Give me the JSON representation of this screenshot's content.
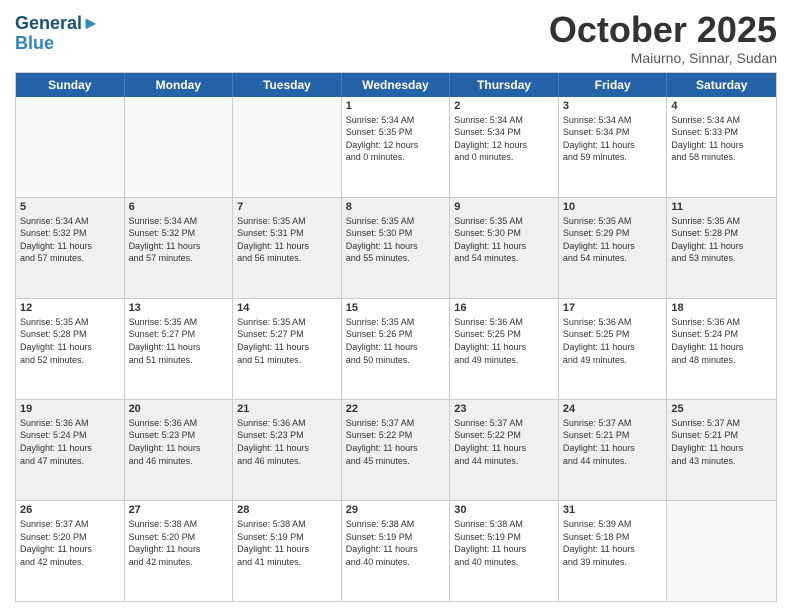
{
  "header": {
    "logo_line1": "General",
    "logo_line2": "Blue",
    "month": "October 2025",
    "location": "Maiurno, Sinnar, Sudan"
  },
  "day_names": [
    "Sunday",
    "Monday",
    "Tuesday",
    "Wednesday",
    "Thursday",
    "Friday",
    "Saturday"
  ],
  "weeks": [
    [
      {
        "day": "",
        "info": ""
      },
      {
        "day": "",
        "info": ""
      },
      {
        "day": "",
        "info": ""
      },
      {
        "day": "1",
        "info": "Sunrise: 5:34 AM\nSunset: 5:35 PM\nDaylight: 12 hours\nand 0 minutes."
      },
      {
        "day": "2",
        "info": "Sunrise: 5:34 AM\nSunset: 5:34 PM\nDaylight: 12 hours\nand 0 minutes."
      },
      {
        "day": "3",
        "info": "Sunrise: 5:34 AM\nSunset: 5:34 PM\nDaylight: 11 hours\nand 59 minutes."
      },
      {
        "day": "4",
        "info": "Sunrise: 5:34 AM\nSunset: 5:33 PM\nDaylight: 11 hours\nand 58 minutes."
      }
    ],
    [
      {
        "day": "5",
        "info": "Sunrise: 5:34 AM\nSunset: 5:32 PM\nDaylight: 11 hours\nand 57 minutes."
      },
      {
        "day": "6",
        "info": "Sunrise: 5:34 AM\nSunset: 5:32 PM\nDaylight: 11 hours\nand 57 minutes."
      },
      {
        "day": "7",
        "info": "Sunrise: 5:35 AM\nSunset: 5:31 PM\nDaylight: 11 hours\nand 56 minutes."
      },
      {
        "day": "8",
        "info": "Sunrise: 5:35 AM\nSunset: 5:30 PM\nDaylight: 11 hours\nand 55 minutes."
      },
      {
        "day": "9",
        "info": "Sunrise: 5:35 AM\nSunset: 5:30 PM\nDaylight: 11 hours\nand 54 minutes."
      },
      {
        "day": "10",
        "info": "Sunrise: 5:35 AM\nSunset: 5:29 PM\nDaylight: 11 hours\nand 54 minutes."
      },
      {
        "day": "11",
        "info": "Sunrise: 5:35 AM\nSunset: 5:28 PM\nDaylight: 11 hours\nand 53 minutes."
      }
    ],
    [
      {
        "day": "12",
        "info": "Sunrise: 5:35 AM\nSunset: 5:28 PM\nDaylight: 11 hours\nand 52 minutes."
      },
      {
        "day": "13",
        "info": "Sunrise: 5:35 AM\nSunset: 5:27 PM\nDaylight: 11 hours\nand 51 minutes."
      },
      {
        "day": "14",
        "info": "Sunrise: 5:35 AM\nSunset: 5:27 PM\nDaylight: 11 hours\nand 51 minutes."
      },
      {
        "day": "15",
        "info": "Sunrise: 5:35 AM\nSunset: 5:26 PM\nDaylight: 11 hours\nand 50 minutes."
      },
      {
        "day": "16",
        "info": "Sunrise: 5:36 AM\nSunset: 5:25 PM\nDaylight: 11 hours\nand 49 minutes."
      },
      {
        "day": "17",
        "info": "Sunrise: 5:36 AM\nSunset: 5:25 PM\nDaylight: 11 hours\nand 49 minutes."
      },
      {
        "day": "18",
        "info": "Sunrise: 5:36 AM\nSunset: 5:24 PM\nDaylight: 11 hours\nand 48 minutes."
      }
    ],
    [
      {
        "day": "19",
        "info": "Sunrise: 5:36 AM\nSunset: 5:24 PM\nDaylight: 11 hours\nand 47 minutes."
      },
      {
        "day": "20",
        "info": "Sunrise: 5:36 AM\nSunset: 5:23 PM\nDaylight: 11 hours\nand 46 minutes."
      },
      {
        "day": "21",
        "info": "Sunrise: 5:36 AM\nSunset: 5:23 PM\nDaylight: 11 hours\nand 46 minutes."
      },
      {
        "day": "22",
        "info": "Sunrise: 5:37 AM\nSunset: 5:22 PM\nDaylight: 11 hours\nand 45 minutes."
      },
      {
        "day": "23",
        "info": "Sunrise: 5:37 AM\nSunset: 5:22 PM\nDaylight: 11 hours\nand 44 minutes."
      },
      {
        "day": "24",
        "info": "Sunrise: 5:37 AM\nSunset: 5:21 PM\nDaylight: 11 hours\nand 44 minutes."
      },
      {
        "day": "25",
        "info": "Sunrise: 5:37 AM\nSunset: 5:21 PM\nDaylight: 11 hours\nand 43 minutes."
      }
    ],
    [
      {
        "day": "26",
        "info": "Sunrise: 5:37 AM\nSunset: 5:20 PM\nDaylight: 11 hours\nand 42 minutes."
      },
      {
        "day": "27",
        "info": "Sunrise: 5:38 AM\nSunset: 5:20 PM\nDaylight: 11 hours\nand 42 minutes."
      },
      {
        "day": "28",
        "info": "Sunrise: 5:38 AM\nSunset: 5:19 PM\nDaylight: 11 hours\nand 41 minutes."
      },
      {
        "day": "29",
        "info": "Sunrise: 5:38 AM\nSunset: 5:19 PM\nDaylight: 11 hours\nand 40 minutes."
      },
      {
        "day": "30",
        "info": "Sunrise: 5:38 AM\nSunset: 5:19 PM\nDaylight: 11 hours\nand 40 minutes."
      },
      {
        "day": "31",
        "info": "Sunrise: 5:39 AM\nSunset: 5:18 PM\nDaylight: 11 hours\nand 39 minutes."
      },
      {
        "day": "",
        "info": ""
      }
    ]
  ]
}
